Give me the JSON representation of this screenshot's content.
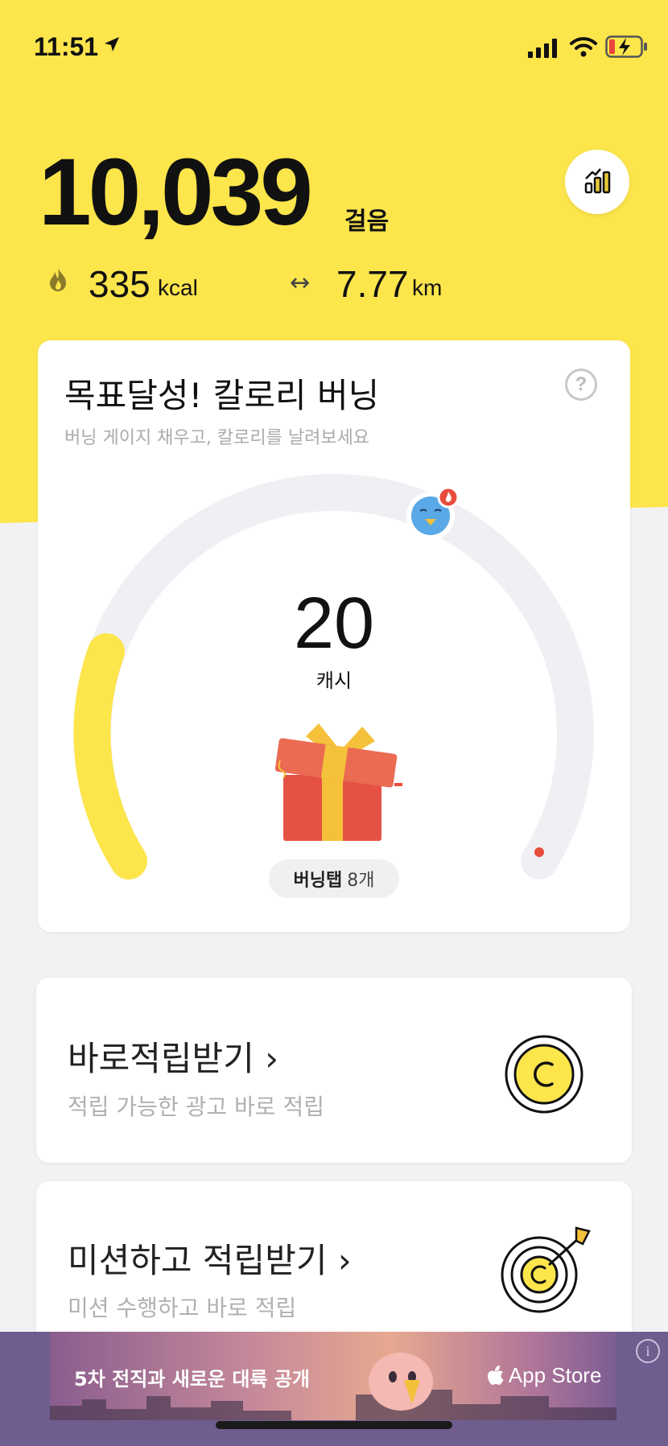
{
  "status": {
    "time": "11:51"
  },
  "steps": {
    "count": "10,039",
    "unit": "걸음"
  },
  "calories": {
    "value": "335",
    "unit": "kcal"
  },
  "distance": {
    "arrow": "↔",
    "value": "7.77",
    "unit": "km"
  },
  "burning_card": {
    "title": "목표달성! 칼로리 버닝",
    "subtitle": "버닝 게이지 채우고, 칼로리를 날려보세요",
    "help": "?",
    "cash_value": "20",
    "cash_unit": "캐시",
    "tap_label": "버닝탭",
    "tap_count": "8개",
    "gauge_progress": 0.15
  },
  "instant_card": {
    "title": "바로적립받기 ›",
    "subtitle": "적립 가능한 광고 바로 적립"
  },
  "mission_card": {
    "title": "미션하고 적립받기 ›",
    "subtitle": "미션 수행하고 바로 적립"
  },
  "ad": {
    "text": "5차 전직과 새로운 대륙 공개",
    "store": " App Store",
    "info": "i"
  },
  "colors": {
    "accent": "#fde54c",
    "gauge_track": "#f0f0f4",
    "red": "#e84c3d"
  }
}
